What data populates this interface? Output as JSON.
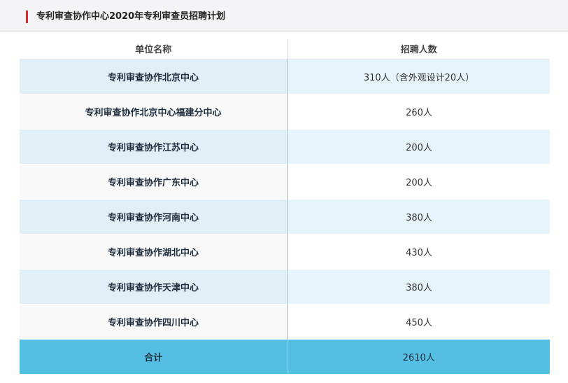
{
  "header": {
    "title": "专利审查协作中心2020年专利审查员招聘计划",
    "accent_color": "#d92b2b"
  },
  "table": {
    "columns": [
      "单位名称",
      "招聘人数"
    ],
    "rows": [
      {
        "unit": "专利审查协作北京中心",
        "count": "310人（含外观设计20人）"
      },
      {
        "unit": "专利审查协作北京中心福建分中心",
        "count": "260人"
      },
      {
        "unit": "专利审查协作江苏中心",
        "count": "200人"
      },
      {
        "unit": "专利审查协作广东中心",
        "count": "200人"
      },
      {
        "unit": "专利审查协作河南中心",
        "count": "380人"
      },
      {
        "unit": "专利审查协作湖北中心",
        "count": "430人"
      },
      {
        "unit": "专利审查协作天津中心",
        "count": "380人"
      },
      {
        "unit": "专利审查协作四川中心",
        "count": "450人"
      }
    ],
    "total": {
      "unit": "合计",
      "count": "2610人"
    },
    "colors": {
      "row_stripe": "#e0eef5",
      "total_row": "#55bee3"
    }
  }
}
